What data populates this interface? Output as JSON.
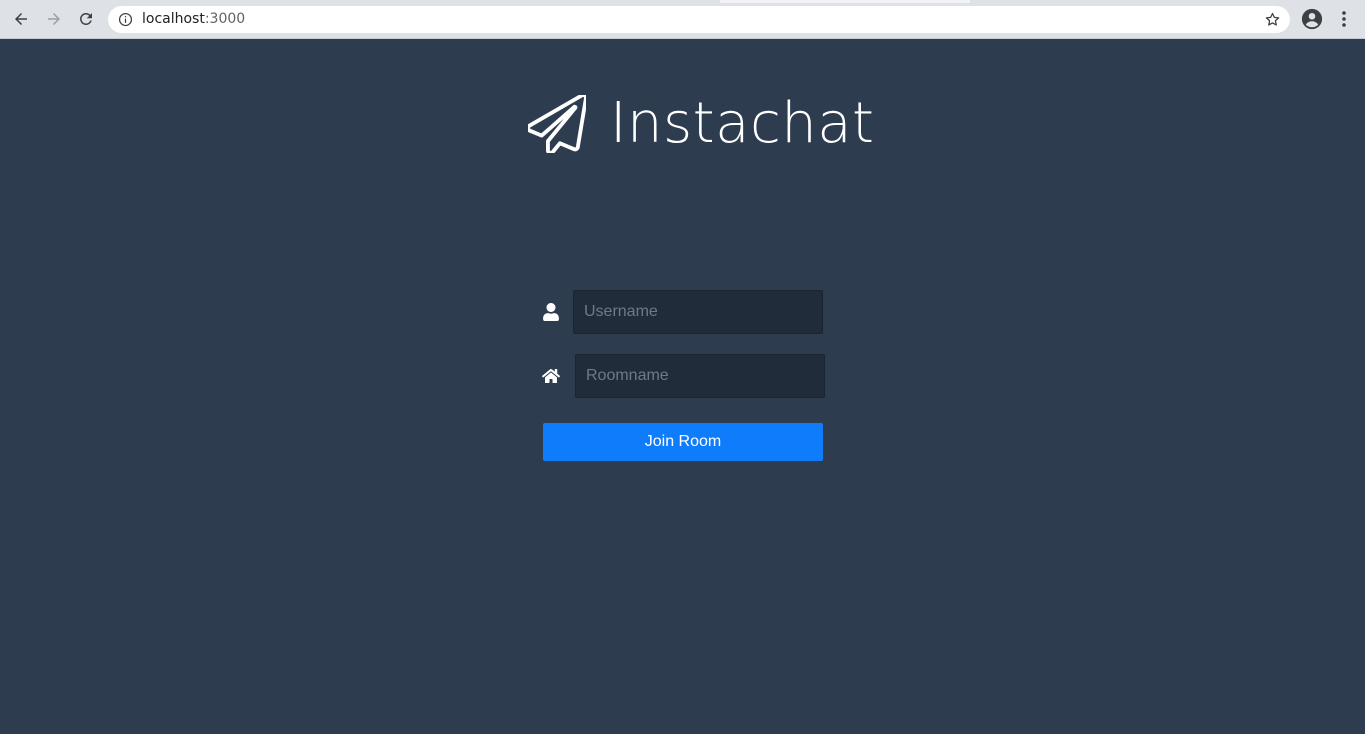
{
  "browser": {
    "url_host": "localhost",
    "url_port": ":3000"
  },
  "app": {
    "title": "Instachat"
  },
  "form": {
    "username_placeholder": "Username",
    "username_value": "",
    "roomname_placeholder": "Roomname",
    "roomname_value": "",
    "join_label": "Join Room"
  },
  "colors": {
    "background": "#2e3c50",
    "input_bg": "#212c3a",
    "button": "#0f7dfb"
  },
  "icons": {
    "brand": "paper-plane-icon",
    "username": "user-icon",
    "roomname": "home-icon"
  }
}
